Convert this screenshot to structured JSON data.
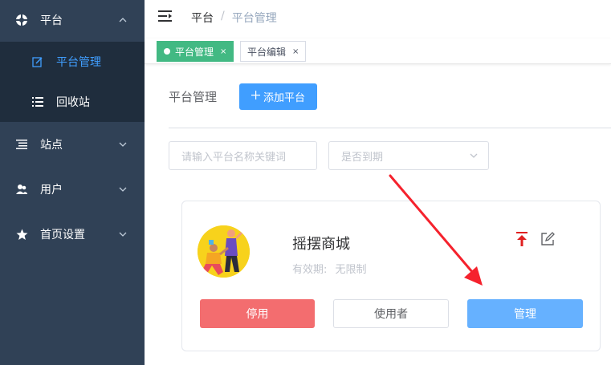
{
  "sidebar": {
    "items": [
      {
        "label": "平台",
        "icon": "platform-icon",
        "expanded": true
      },
      {
        "label": "平台管理",
        "icon": "edit-icon",
        "active": true
      },
      {
        "label": "回收站",
        "icon": "list-icon"
      },
      {
        "label": "站点",
        "icon": "list-tree-icon"
      },
      {
        "label": "用户",
        "icon": "user-icon"
      },
      {
        "label": "首页设置",
        "icon": "star-icon"
      }
    ]
  },
  "breadcrumb": {
    "home": "平台",
    "separator": "/",
    "current": "平台管理"
  },
  "tags": [
    {
      "label": "平台管理",
      "close": "×",
      "active": true
    },
    {
      "label": "平台编辑",
      "close": "×",
      "active": false
    }
  ],
  "page": {
    "title": "平台管理",
    "add_button": "添加平台",
    "search_placeholder": "请输入平台名称关键词",
    "expiry_placeholder": "是否到期"
  },
  "card": {
    "name": "摇摆商城",
    "validity_label": "有效期:",
    "validity_value": "无限制",
    "stop_button": "停用",
    "users_button": "使用者",
    "manage_button": "管理"
  },
  "colors": {
    "sidebar_bg": "#304156",
    "submenu_bg": "#1f2d3d",
    "accent": "#409eff",
    "tag_active": "#42b983",
    "danger": "#f36d6f",
    "annotation_arrow": "#f5222d"
  }
}
